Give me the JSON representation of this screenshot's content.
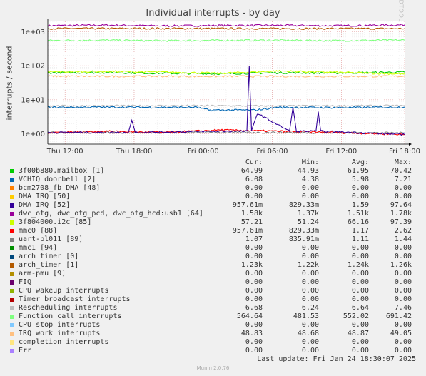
{
  "title": "Individual interrupts - by day",
  "watermark": "RRDTOOL / TOBI OETIKER",
  "footer": "Munin 2.0.76",
  "last_update": "Last update: Fri Jan 24 18:30:07 2025",
  "legend_headers": {
    "cur": "Cur:",
    "min": "Min:",
    "avg": "Avg:",
    "max": "Max:"
  },
  "legend": [
    {
      "name": "3f00b880.mailbox [1]",
      "color": "#00cc00",
      "cur": "64.99",
      "min": "44.93",
      "avg": "61.95",
      "max": "70.42"
    },
    {
      "name": "VCHIQ doorbell [2]",
      "color": "#0066b3",
      "cur": "6.08",
      "min": "4.38",
      "avg": "5.98",
      "max": "7.21"
    },
    {
      "name": "bcm2708_fb DMA [48]",
      "color": "#ff8000",
      "cur": "0.00",
      "min": "0.00",
      "avg": "0.00",
      "max": "0.00"
    },
    {
      "name": "DMA IRQ [50]",
      "color": "#ffcc00",
      "cur": "0.00",
      "min": "0.00",
      "avg": "0.00",
      "max": "0.00"
    },
    {
      "name": "DMA IRQ [52]",
      "color": "#330099",
      "cur": "957.61m",
      "min": "829.33m",
      "avg": "1.59",
      "max": "97.64"
    },
    {
      "name": "dwc_otg, dwc_otg_pcd, dwc_otg_hcd:usb1 [64]",
      "color": "#990099",
      "cur": "1.58k",
      "min": "1.37k",
      "avg": "1.51k",
      "max": "1.78k"
    },
    {
      "name": "3f804000.i2c [85]",
      "color": "#ccff00",
      "cur": "57.21",
      "min": "51.24",
      "avg": "66.16",
      "max": "97.39"
    },
    {
      "name": "mmc0 [88]",
      "color": "#ff0000",
      "cur": "957.61m",
      "min": "829.33m",
      "avg": "1.17",
      "max": "2.62"
    },
    {
      "name": "uart-pl011 [89]",
      "color": "#808080",
      "cur": "1.07",
      "min": "835.91m",
      "avg": "1.11",
      "max": "1.44"
    },
    {
      "name": "mmc1 [94]",
      "color": "#008f00",
      "cur": "0.00",
      "min": "0.00",
      "avg": "0.00",
      "max": "0.00"
    },
    {
      "name": "arch_timer [0]",
      "color": "#00487d",
      "cur": "0.00",
      "min": "0.00",
      "avg": "0.00",
      "max": "0.00"
    },
    {
      "name": "arch_timer [1]",
      "color": "#b35a00",
      "cur": "1.23k",
      "min": "1.22k",
      "avg": "1.24k",
      "max": "1.26k"
    },
    {
      "name": "arm-pmu [9]",
      "color": "#b38f00",
      "cur": "0.00",
      "min": "0.00",
      "avg": "0.00",
      "max": "0.00"
    },
    {
      "name": "FIQ",
      "color": "#6b006b",
      "cur": "0.00",
      "min": "0.00",
      "avg": "0.00",
      "max": "0.00"
    },
    {
      "name": "CPU wakeup interrupts",
      "color": "#8fb300",
      "cur": "0.00",
      "min": "0.00",
      "avg": "0.00",
      "max": "0.00"
    },
    {
      "name": "Timer broadcast interrupts",
      "color": "#b30000",
      "cur": "0.00",
      "min": "0.00",
      "avg": "0.00",
      "max": "0.00"
    },
    {
      "name": "Rescheduling interrupts",
      "color": "#bebebe",
      "cur": "6.68",
      "min": "6.24",
      "avg": "6.64",
      "max": "7.46"
    },
    {
      "name": "Function call interrupts",
      "color": "#80ff80",
      "cur": "564.64",
      "min": "481.53",
      "avg": "552.02",
      "max": "691.42"
    },
    {
      "name": "CPU stop interrupts",
      "color": "#80c9ff",
      "cur": "0.00",
      "min": "0.00",
      "avg": "0.00",
      "max": "0.00"
    },
    {
      "name": "IRQ work interrupts",
      "color": "#ffc080",
      "cur": "48.83",
      "min": "48.68",
      "avg": "48.87",
      "max": "49.05"
    },
    {
      "name": "completion interrupts",
      "color": "#ffe680",
      "cur": "0.00",
      "min": "0.00",
      "avg": "0.00",
      "max": "0.00"
    },
    {
      "name": "Err",
      "color": "#aa80ff",
      "cur": "0.00",
      "min": "0.00",
      "avg": "0.00",
      "max": "0.00"
    }
  ],
  "chart_data": {
    "type": "line",
    "title": "Individual interrupts - by day",
    "ylabel": "interrupts / second",
    "yscale": "log",
    "ylim": [
      0.5,
      2000
    ],
    "ytick_labels": [
      "1e+00",
      "1e+01",
      "1e+02",
      "1e+03"
    ],
    "ytick_values": [
      1,
      10,
      100,
      1000
    ],
    "xlabel": "",
    "xtick_labels": [
      "Thu 12:00",
      "Thu 18:00",
      "Fri 00:00",
      "Fri 06:00",
      "Fri 12:00",
      "Fri 18:00"
    ],
    "x_range_hours": [
      0,
      31
    ],
    "x_hours_at_ticks": [
      1.5,
      7.5,
      13.5,
      19.5,
      25.5,
      31.5
    ],
    "grid": true,
    "series": [
      {
        "name": "dwc_otg, dwc_otg_pcd, dwc_otg_hcd:usb1 [64]",
        "color": "#990099",
        "x": [
          0,
          5,
          10,
          15,
          20,
          25,
          31
        ],
        "y": [
          1500,
          1550,
          1480,
          1520,
          1530,
          1490,
          1580
        ]
      },
      {
        "name": "arch_timer [1]",
        "color": "#b35a00",
        "x": [
          0,
          10,
          20,
          31
        ],
        "y": [
          1240,
          1240,
          1230,
          1230
        ]
      },
      {
        "name": "Function call interrupts",
        "color": "#80ff80",
        "x": [
          0,
          5,
          10,
          15,
          20,
          25,
          31
        ],
        "y": [
          550,
          560,
          540,
          555,
          560,
          545,
          565
        ]
      },
      {
        "name": "3f00b880.mailbox [1]",
        "color": "#00cc00",
        "x": [
          0,
          5,
          10,
          15,
          20,
          25,
          31
        ],
        "y": [
          62,
          63,
          60,
          58,
          62,
          61,
          65
        ]
      },
      {
        "name": "3f804000.i2c [85]",
        "color": "#ccff00",
        "x": [
          0,
          5,
          10,
          15,
          20,
          25,
          31
        ],
        "y": [
          66,
          68,
          65,
          60,
          70,
          64,
          57
        ]
      },
      {
        "name": "IRQ work interrupts",
        "color": "#ffc080",
        "x": [
          0,
          10,
          20,
          31
        ],
        "y": [
          48.9,
          48.9,
          48.8,
          48.8
        ]
      },
      {
        "name": "Rescheduling interrupts",
        "color": "#bebebe",
        "x": [
          0,
          10,
          20,
          31
        ],
        "y": [
          6.6,
          6.7,
          6.6,
          6.7
        ]
      },
      {
        "name": "VCHIQ doorbell [2]",
        "color": "#0066b3",
        "x": [
          0,
          5,
          10,
          13,
          14,
          18,
          20,
          25,
          31
        ],
        "y": [
          6.0,
          6.1,
          6.0,
          6.0,
          5.0,
          5.0,
          6.0,
          5.9,
          6.1
        ]
      },
      {
        "name": "uart-pl011 [89]",
        "color": "#808080",
        "x": [
          0,
          10,
          20,
          31
        ],
        "y": [
          1.1,
          1.1,
          1.1,
          1.07
        ]
      },
      {
        "name": "mmc0 [88]",
        "color": "#ff0000",
        "x": [
          0,
          5,
          10,
          15,
          20,
          25,
          31
        ],
        "y": [
          1.1,
          1.2,
          1.1,
          1.3,
          1.2,
          1.1,
          0.96
        ]
      },
      {
        "name": "DMA IRQ [52]",
        "color": "#330099",
        "x": [
          0,
          7,
          7.3,
          7.6,
          15,
          17.3,
          17.5,
          17.7,
          18.2,
          21,
          21.3,
          21.6,
          23.3,
          23.5,
          23.7,
          31
        ],
        "y": [
          1.1,
          1.1,
          2.5,
          1.1,
          1.2,
          1.2,
          97.6,
          1.2,
          4.0,
          1.2,
          6.0,
          1.2,
          1.2,
          4.5,
          1.2,
          0.96
        ]
      }
    ]
  }
}
